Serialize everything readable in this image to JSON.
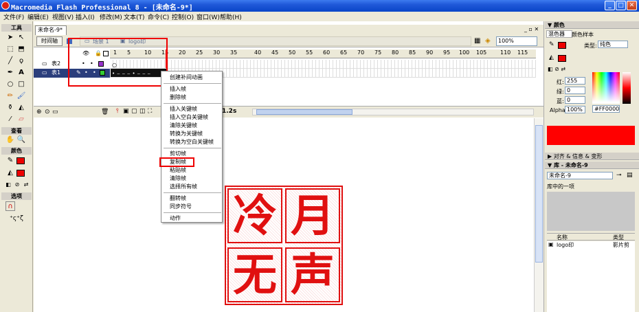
{
  "window": {
    "title": "Macromedia Flash Professional 8 - [未命名-9*]"
  },
  "menu": [
    "文件(F)",
    "编辑(E)",
    "视图(V)",
    "插入(I)",
    "修改(M)",
    "文本(T)",
    "命令(C)",
    "控制(O)",
    "窗口(W)",
    "帮助(H)"
  ],
  "tools": {
    "title": "工具",
    "view": "查看",
    "colors": "颜色",
    "options": "选项"
  },
  "document": {
    "tab": "未命名-9*",
    "timeline_button": "时间轴",
    "scene": "场景 1",
    "symbol": "logo印",
    "zoom": "100%"
  },
  "timeline": {
    "ruler": [
      "1",
      "5",
      "10",
      "15",
      "20",
      "25",
      "30",
      "35",
      "40",
      "45",
      "50",
      "55",
      "60",
      "65",
      "70",
      "75",
      "80",
      "85",
      "90",
      "95",
      "100",
      "105",
      "110",
      "115"
    ],
    "layers": [
      {
        "name": "表2"
      },
      {
        "name": "表1"
      }
    ],
    "time": "1.2s"
  },
  "context_menu": {
    "items": [
      "创建补间动画",
      "插入帧",
      "删除帧",
      "插入关键帧",
      "插入空白关键帧",
      "清除关键帧",
      "转换为关键帧",
      "转换为空白关键帧",
      "剪切帧",
      "复制帧",
      "粘贴帧",
      "清除帧",
      "选择所有帧",
      "翻转帧",
      "同步符号",
      "动作"
    ],
    "highlighted": "复制帧"
  },
  "color_panel": {
    "title": "颜色",
    "tabs": [
      "混色器",
      "颜色样本"
    ],
    "type_label": "类型:",
    "type_value": "纯色",
    "red_label": "红:",
    "red": "255",
    "green_label": "绿:",
    "green": "0",
    "blue_label": "蓝:",
    "blue": "0",
    "alpha_label": "Alpha:",
    "alpha": "100%",
    "hex": "#FF0000",
    "color": "#FF0000"
  },
  "align_panel": {
    "title": "对齐 & 信息 & 变形"
  },
  "library": {
    "title": "库 - 未命名-9",
    "selector": "未命名-9",
    "count": "库中的一项",
    "col_name": "名称",
    "col_type": "类型",
    "items": [
      {
        "name": "logo印",
        "type": "影片剪"
      }
    ]
  },
  "seal": {
    "chars": [
      "冷",
      "月",
      "无",
      "声"
    ],
    "color": "#E01010"
  }
}
